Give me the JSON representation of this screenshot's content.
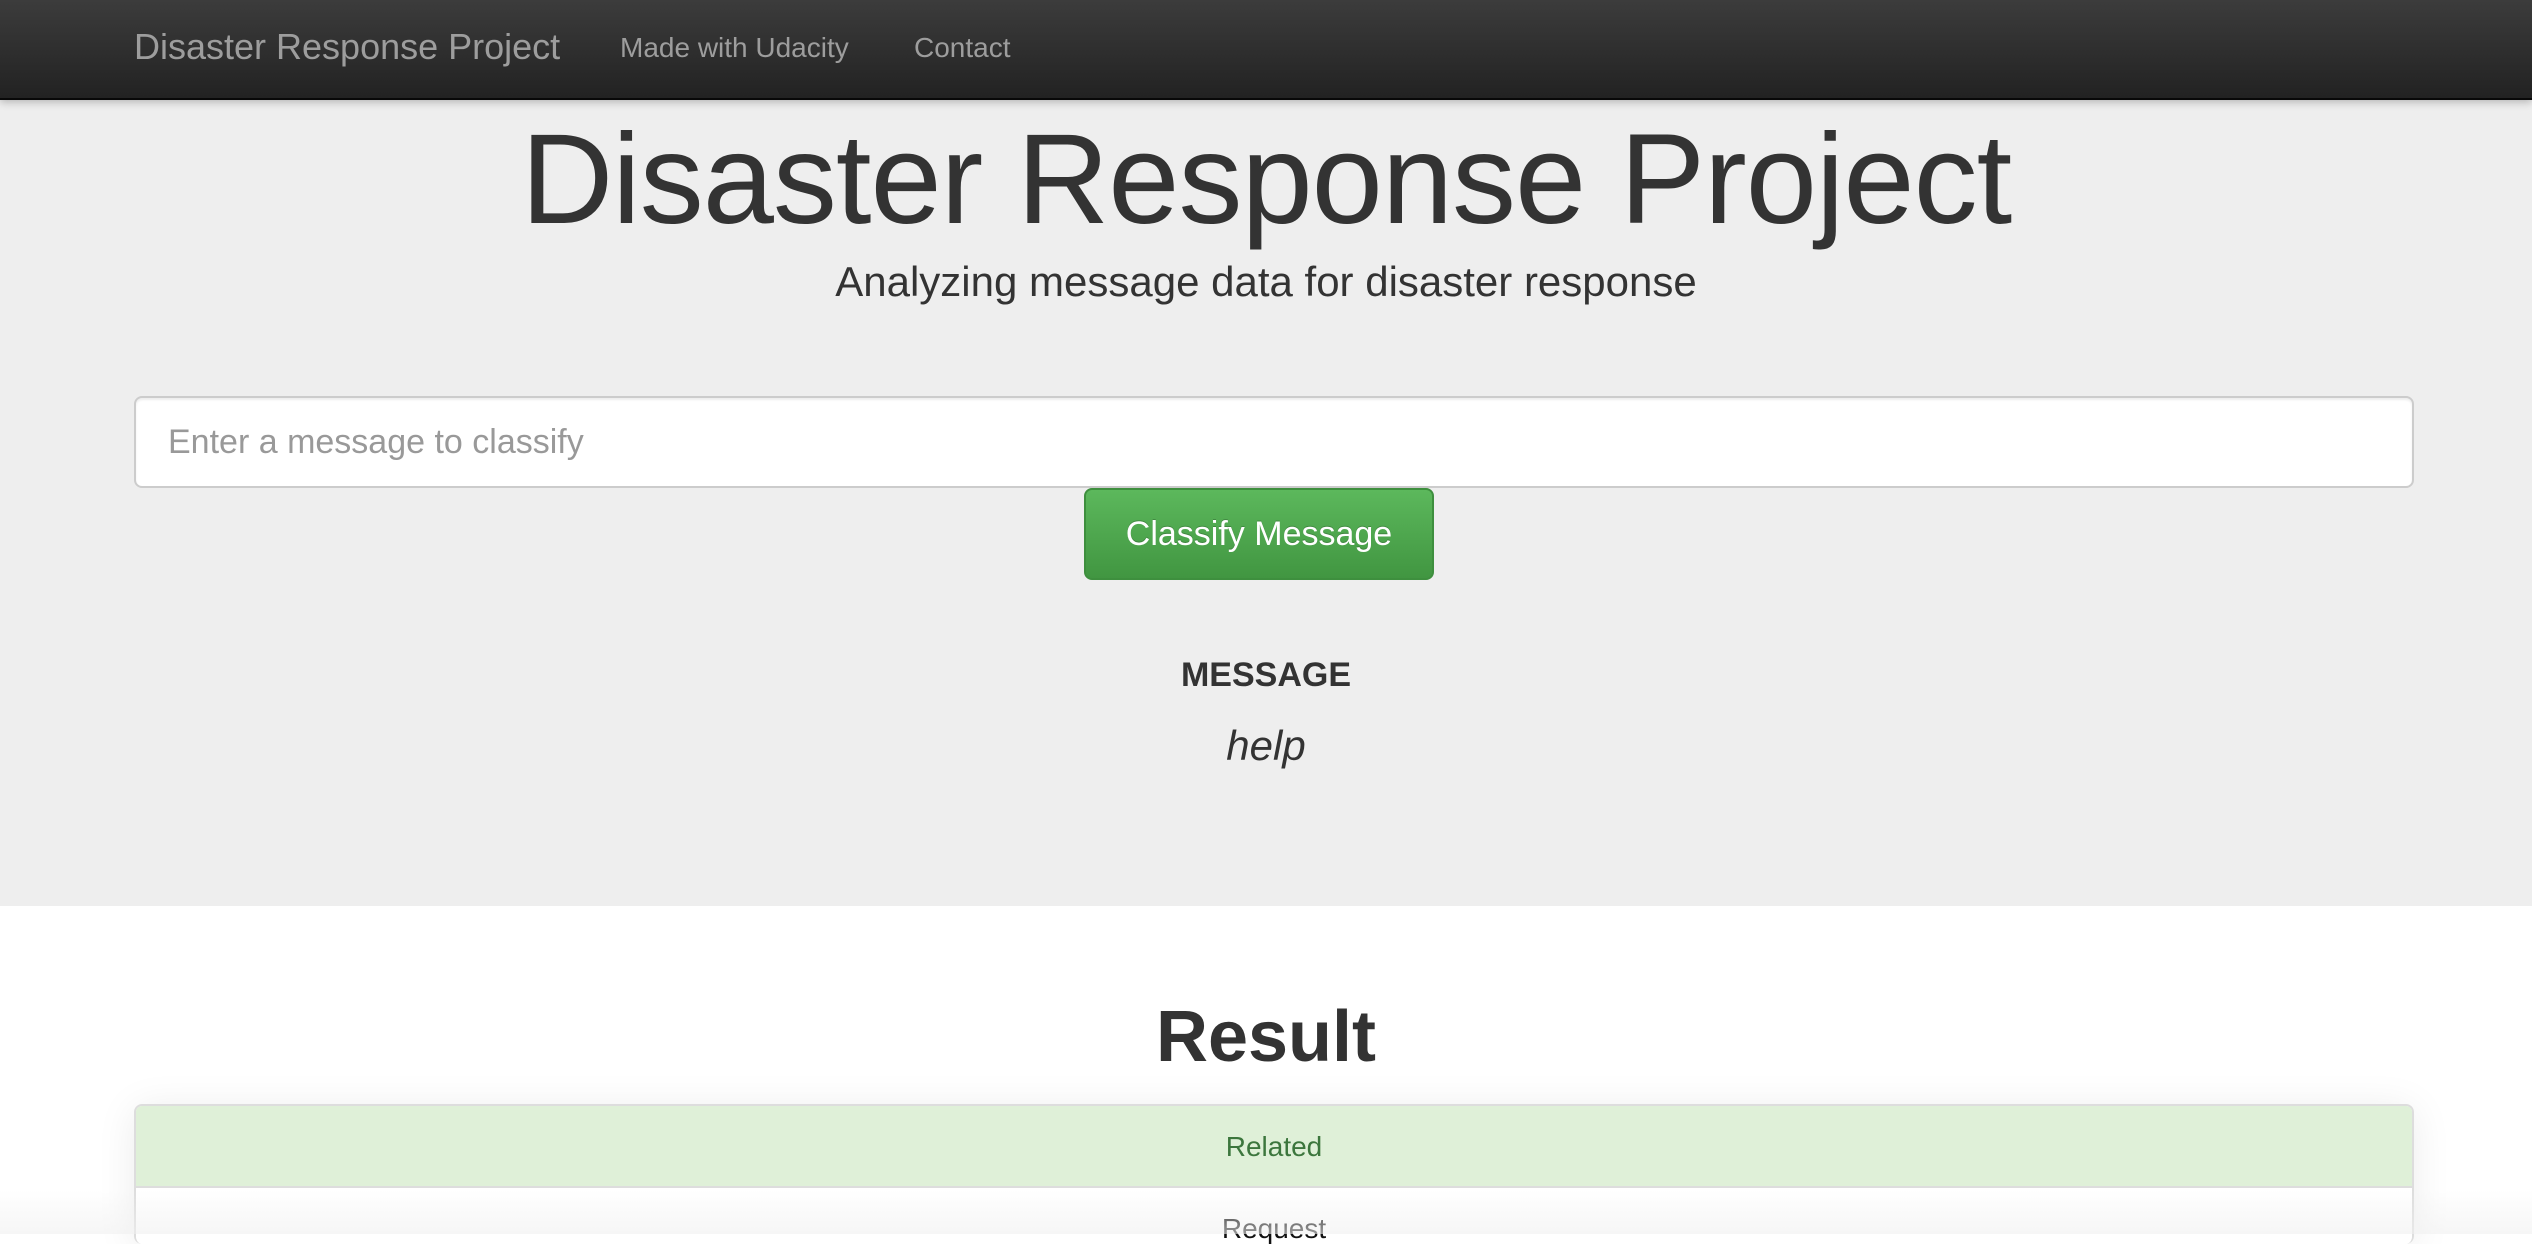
{
  "navbar": {
    "brand": "Disaster Response Project",
    "links": [
      {
        "label": "Made with Udacity"
      },
      {
        "label": "Contact"
      }
    ]
  },
  "hero": {
    "title": "Disaster Response Project",
    "subtitle": "Analyzing message data for disaster response"
  },
  "form": {
    "input_placeholder": "Enter a message to classify",
    "input_value": "",
    "button_label": "Classify Message"
  },
  "message": {
    "label": "MESSAGE",
    "value": "help"
  },
  "result": {
    "title": "Result",
    "categories": [
      {
        "label": "Related",
        "status": "positive"
      },
      {
        "label": "Request",
        "status": "negative"
      }
    ]
  },
  "colors": {
    "navbar_bg": "#222222",
    "jumbotron_bg": "#eeeeee",
    "button_green": "#5cb85c",
    "success_bg": "#dff0d8",
    "success_text": "#3c763d"
  }
}
